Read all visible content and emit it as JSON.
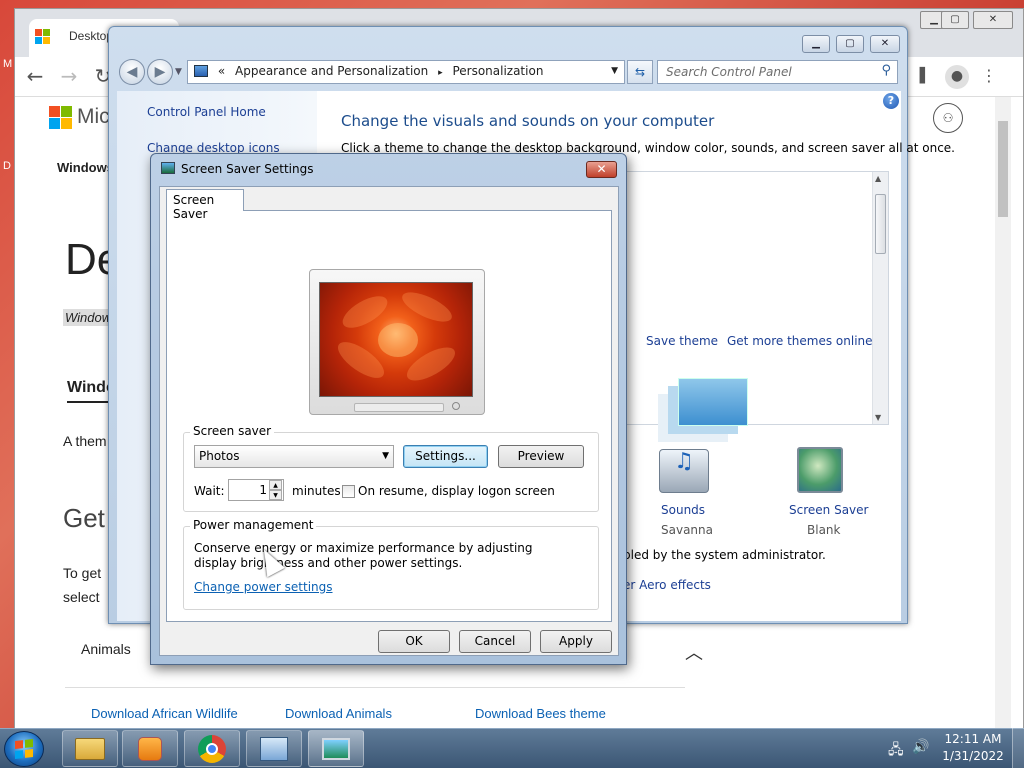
{
  "chrome": {
    "tab_title": "Desktop T",
    "page_heading_partial": "De",
    "page_subtitle_partial": "Window",
    "nav_partial": "Windows",
    "section_partial": "Windo",
    "text_partial": "A them",
    "get_partial": "Get",
    "body_partial_1": "To get",
    "body_partial_2": "select",
    "left_fragment_s": "s",
    "left_fragment_t": "T",
    "animals_label": "Animals",
    "downloads": [
      "Download African Wildlife",
      "Download Animals",
      "Download Bees theme"
    ],
    "logo_partial": "Mic",
    "d_letter": "D",
    "m_letter": "M"
  },
  "control_panel": {
    "breadcrumb": [
      "«",
      "Appearance and Personalization",
      "▸",
      "Personalization"
    ],
    "search_placeholder": "Search Control Panel",
    "left_links": [
      "Control Panel Home",
      "Change desktop icons"
    ],
    "title": "Change the visuals and sounds on your computer",
    "subtitle": "Click a theme to change the desktop background, window color, sounds, and screen saver all at once.",
    "theme_links": [
      "Save theme",
      "Get more themes online"
    ],
    "settings": [
      {
        "label": "Sounds",
        "value": "Savanna"
      },
      {
        "label": "Screen Saver",
        "value": "Blank"
      }
    ],
    "admin_text": "bled by the system administrator.",
    "aero_text": "er Aero effects"
  },
  "dialog": {
    "title": "Screen Saver Settings",
    "tab": "Screen Saver",
    "screensaver_group": "Screen saver",
    "screensaver_selected": "Photos",
    "settings_button": "Settings...",
    "preview_button": "Preview",
    "wait_label": "Wait:",
    "wait_value": "1",
    "minutes_label": "minutes",
    "resume_checkbox": "On resume, display logon screen",
    "resume_checked": false,
    "power_group": "Power management",
    "power_text": "Conserve energy or maximize performance by adjusting display brightness and other power settings.",
    "power_link": "Change power settings",
    "ok": "OK",
    "cancel": "Cancel",
    "apply": "Apply"
  },
  "taskbar": {
    "time": "12:11 AM",
    "date": "1/31/2022",
    "apps": [
      "explorer-icon",
      "media-player-icon",
      "chrome-icon",
      "control-panel-icon",
      "display-settings-icon"
    ]
  },
  "colors": {
    "ms_red": "#f25022",
    "ms_green": "#7fba00",
    "ms_blue": "#00a4ef",
    "ms_yellow": "#ffb900",
    "link_blue": "#0b61b3",
    "cp_title_blue": "#1c4c8c"
  }
}
